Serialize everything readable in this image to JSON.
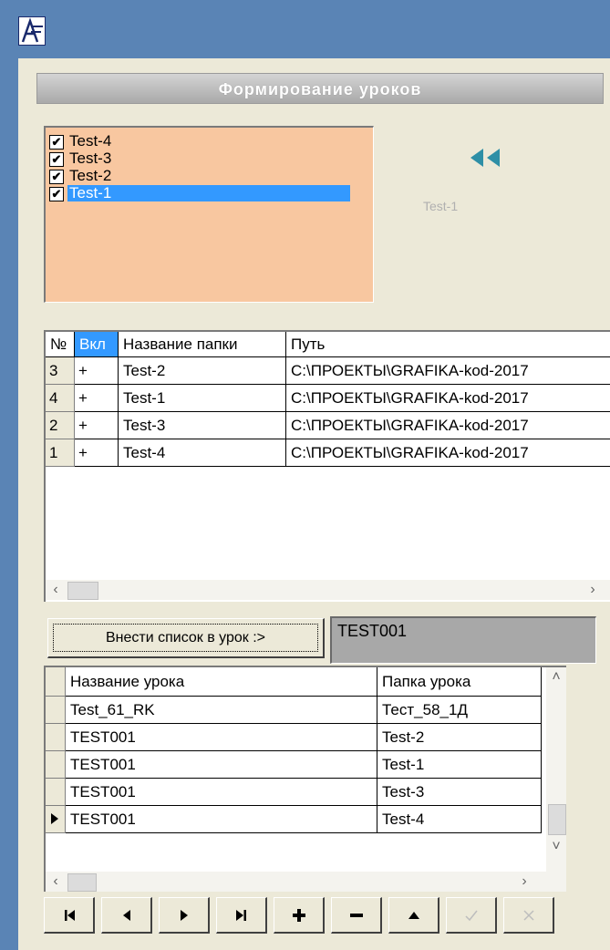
{
  "header": {
    "title": "Формирование уроков"
  },
  "folder_list": {
    "items": [
      {
        "label": "Test-4",
        "checked": true,
        "selected": false
      },
      {
        "label": "Test-3",
        "checked": true,
        "selected": false
      },
      {
        "label": "Test-2",
        "checked": true,
        "selected": false
      },
      {
        "label": "Test-1",
        "checked": true,
        "selected": true
      }
    ]
  },
  "preview_label": "Test-1",
  "folders_grid": {
    "columns": [
      "№",
      "Вкл",
      "Название папки",
      "Путь"
    ],
    "rows": [
      {
        "num": "3",
        "on": "+",
        "name": "Test-2",
        "path": "C:\\ПРОЕКТЫ\\GRAFIKA-kod-2017"
      },
      {
        "num": "4",
        "on": "+",
        "name": "Test-1",
        "path": "C:\\ПРОЕКТЫ\\GRAFIKA-kod-2017"
      },
      {
        "num": "2",
        "on": "+",
        "name": "Test-3",
        "path": "C:\\ПРОЕКТЫ\\GRAFIKA-kod-2017"
      },
      {
        "num": "1",
        "on": "+",
        "name": "Test-4",
        "path": "C:\\ПРОЕКТЫ\\GRAFIKA-kod-2017"
      }
    ]
  },
  "add_button_label": "Внести список в урок :>",
  "lesson_name_value": "TEST001",
  "lessons_grid": {
    "columns": [
      "Название урока",
      "Папка урока"
    ],
    "rows": [
      {
        "lesson": "Test_61_RK",
        "folder": "Тест_58_1Д"
      },
      {
        "lesson": "TEST001",
        "folder": "Test-2"
      },
      {
        "lesson": "TEST001",
        "folder": "Test-1"
      },
      {
        "lesson": "TEST001",
        "folder": "Test-3"
      },
      {
        "lesson": "TEST001",
        "folder": "Test-4"
      }
    ],
    "current_row_index": 4
  },
  "navigator": {
    "buttons": [
      "first-record",
      "prior-record",
      "next-record",
      "last-record",
      "insert-record",
      "delete-record",
      "edit-record",
      "post-edit",
      "cancel-edit"
    ]
  },
  "colors": {
    "title_bar": "#5a84b5",
    "list_background": "#f8c7a0",
    "selection": "#3399ff",
    "arrow_teal": "#2e8fa6"
  }
}
